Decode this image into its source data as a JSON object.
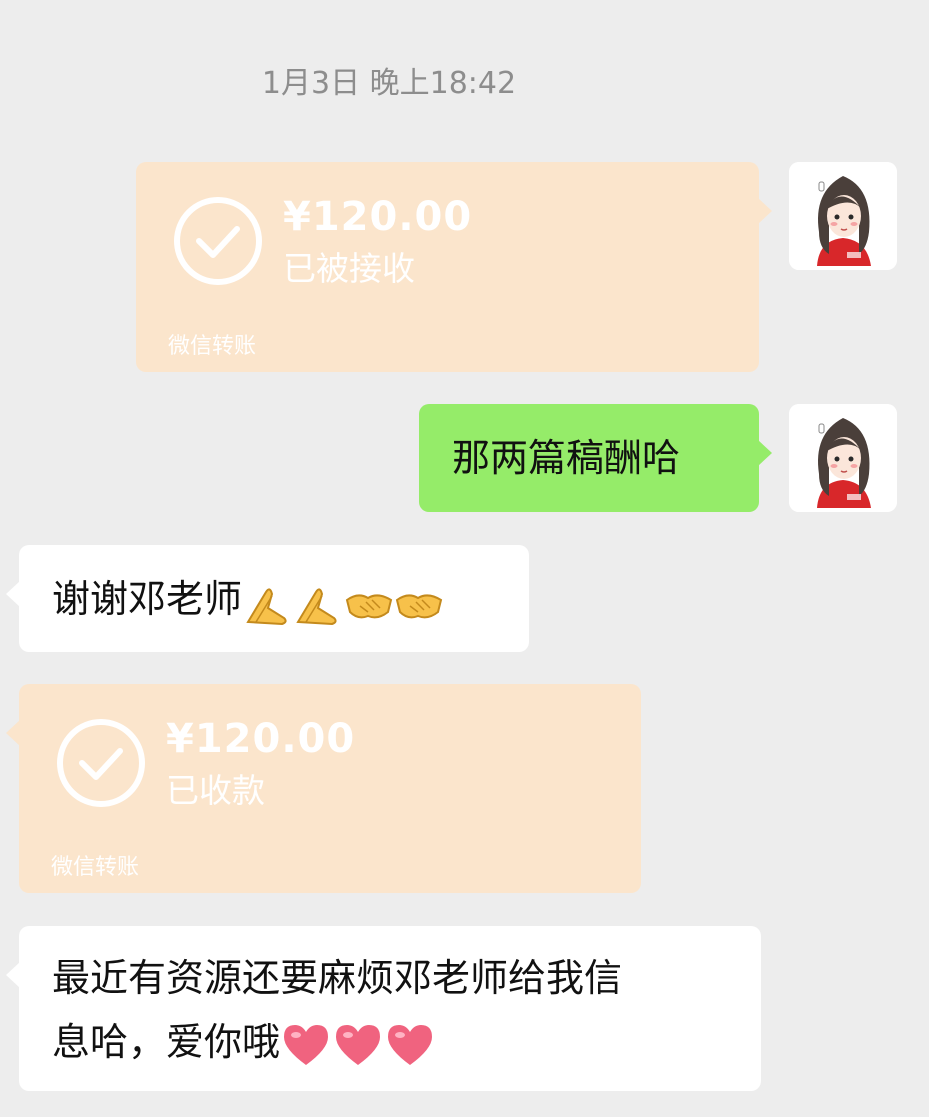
{
  "chat": {
    "timestamp": "1月3日 晚上18:42",
    "transfer_sent": {
      "amount": "¥120.00",
      "status": "已被接收",
      "label": "微信转账"
    },
    "message_sent": {
      "text": "那两篇稿酬哈"
    },
    "reply_1": {
      "text": "谢谢邓老师",
      "emojis": [
        "folded-hands",
        "folded-hands",
        "handshake",
        "handshake"
      ]
    },
    "transfer_received": {
      "amount": "¥120.00",
      "status": "已收款",
      "label": "微信转账"
    },
    "reply_2": {
      "line1": "最近有资源还要麻烦邓老师给我信",
      "line2": "息哈，爱你哦",
      "emojis": [
        "heart",
        "heart",
        "heart"
      ]
    }
  },
  "colors": {
    "background": "#ededed",
    "transfer_card": "#fbe5cc",
    "sent_bubble": "#95ec69",
    "received_bubble": "#ffffff",
    "timestamp_text": "#8d8d8d"
  }
}
